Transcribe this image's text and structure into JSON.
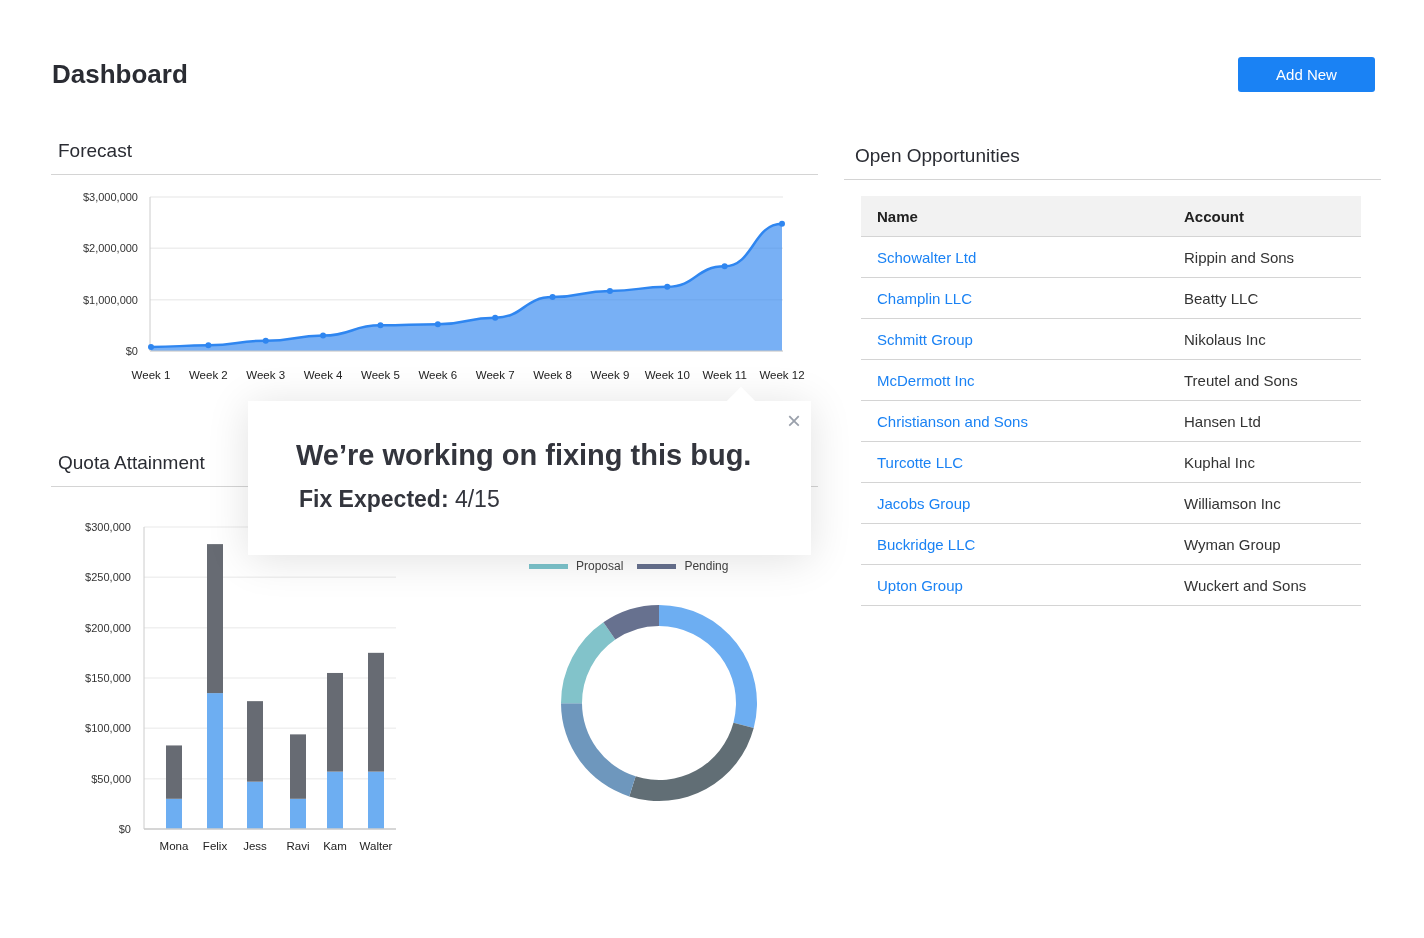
{
  "header": {
    "title": "Dashboard",
    "add_button": "Add New"
  },
  "forecast": {
    "title": "Forecast",
    "chart_data": {
      "type": "area",
      "categories": [
        "Week 1",
        "Week 2",
        "Week 3",
        "Week 4",
        "Week 5",
        "Week 6",
        "Week 7",
        "Week 8",
        "Week 9",
        "Week 10",
        "Week 11",
        "Week 12"
      ],
      "series": [
        {
          "color": "#2f86f0",
          "values": [
            80000,
            110000,
            200000,
            300000,
            500000,
            520000,
            650000,
            1050000,
            1170000,
            1250000,
            1650000,
            2480000
          ]
        }
      ],
      "grid": true,
      "ylim": [
        0,
        3000000
      ],
      "yticks": [
        {
          "value": 0,
          "label": "$0"
        },
        {
          "value": 1000000,
          "label": "$1,000,000"
        },
        {
          "value": 2000000,
          "label": "$2,000,000"
        },
        {
          "value": 3000000,
          "label": "$3,000,000"
        }
      ]
    }
  },
  "quota": {
    "title": "Quota Attainment",
    "chart_data": {
      "type": "bar",
      "stacked": true,
      "categories": [
        "Mona",
        "Felix",
        "Jess",
        "Ravi",
        "Kam",
        "Walter"
      ],
      "series": [
        {
          "color": "#6daef2",
          "values": [
            30000,
            135000,
            47000,
            30000,
            57000,
            57000
          ]
        },
        {
          "color": "#676b73",
          "values": [
            53000,
            148000,
            80000,
            64000,
            98000,
            118000
          ]
        }
      ],
      "grid": true,
      "ylim": [
        0,
        300000
      ],
      "yticks": [
        {
          "value": 0,
          "label": "$0"
        },
        {
          "value": 50000,
          "label": "$50,000"
        },
        {
          "value": 100000,
          "label": "$100,000"
        },
        {
          "value": 150000,
          "label": "$150,000"
        },
        {
          "value": 200000,
          "label": "$200,000"
        },
        {
          "value": 250000,
          "label": "$250,000"
        },
        {
          "value": 300000,
          "label": "$300,000"
        }
      ]
    },
    "legend": [
      {
        "label": "Proposal",
        "color": "#7cc4cc"
      },
      {
        "label": "Pending",
        "color": "#67718f"
      }
    ]
  },
  "opportunities": {
    "title": "Open Opportunities",
    "columns": [
      "Name",
      "Account"
    ],
    "rows": [
      {
        "name": "Schowalter Ltd",
        "account": "Rippin and Sons"
      },
      {
        "name": "Champlin LLC",
        "account": "Beatty LLC"
      },
      {
        "name": "Schmitt Group",
        "account": "Nikolaus Inc"
      },
      {
        "name": "McDermott Inc",
        "account": "Treutel and Sons"
      },
      {
        "name": "Christianson and Sons",
        "account": "Hansen Ltd"
      },
      {
        "name": "Turcotte LLC",
        "account": "Kuphal Inc"
      },
      {
        "name": "Jacobs Group",
        "account": "Williamson Inc"
      },
      {
        "name": "Buckridge LLC",
        "account": "Wyman Group"
      },
      {
        "name": "Upton Group",
        "account": "Wuckert and Sons"
      }
    ]
  },
  "popup": {
    "close": "×",
    "message": "We’re working on fixing this bug.",
    "detail": "**Fix Expected:** 4/15"
  }
}
